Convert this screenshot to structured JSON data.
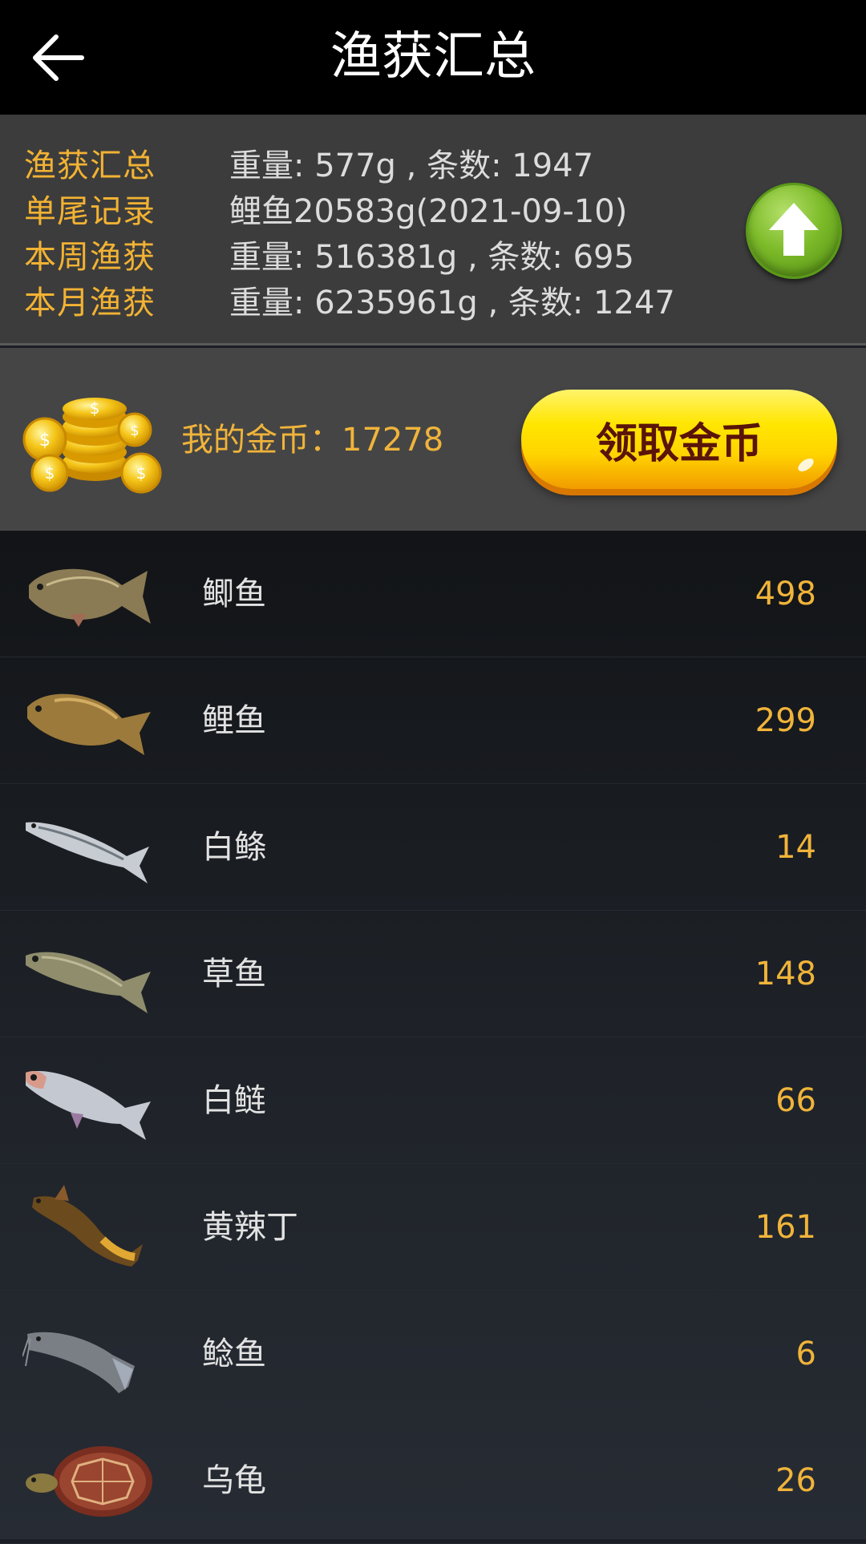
{
  "header": {
    "title": "渔获汇总",
    "back_icon": "arrow-left-icon"
  },
  "stats": {
    "rows": [
      {
        "label": "渔获汇总",
        "value": "重量: 577g , 条数: 1947"
      },
      {
        "label": "单尾记录",
        "value": "鲤鱼20583g(2021-09-10)"
      },
      {
        "label": "本周渔获",
        "value": "重量: 516381g , 条数: 695"
      },
      {
        "label": "本月渔获",
        "value": "重量: 6235961g , 条数: 1247"
      }
    ],
    "upload_icon": "arrow-up-icon"
  },
  "coins": {
    "label": "我的金币：",
    "amount": "17278",
    "claim_label": "领取金币",
    "icon": "gold-coins-icon"
  },
  "fish": [
    {
      "name": "鲫鱼",
      "count": "498",
      "icon": "crucian-carp-icon"
    },
    {
      "name": "鲤鱼",
      "count": "299",
      "icon": "carp-icon"
    },
    {
      "name": "白鲦",
      "count": "14",
      "icon": "sharpbelly-icon"
    },
    {
      "name": "草鱼",
      "count": "148",
      "icon": "grass-carp-icon"
    },
    {
      "name": "白鲢",
      "count": "66",
      "icon": "silver-carp-icon"
    },
    {
      "name": "黄辣丁",
      "count": "161",
      "icon": "yellow-catfish-icon"
    },
    {
      "name": "鲶鱼",
      "count": "6",
      "icon": "catfish-icon"
    },
    {
      "name": "乌龟",
      "count": "26",
      "icon": "turtle-icon"
    }
  ],
  "colors": {
    "accent_gold": "#f0b43a",
    "header_bg": "#000000",
    "stats_bg": "#3c3c3c",
    "coins_bg": "#454545",
    "button_yellow": "#ffe600",
    "upload_green": "#7dbb2a"
  }
}
